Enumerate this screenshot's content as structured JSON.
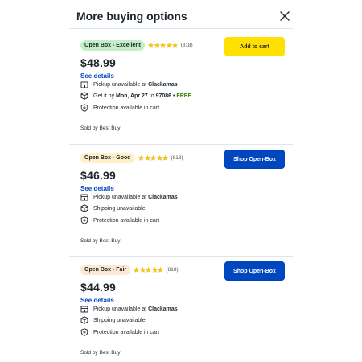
{
  "header": {
    "title": "More buying options"
  },
  "colors": {
    "excellent_badge": "#c3eec8",
    "good_badge": "#fff0c8",
    "fair_badge": "#fde8d4",
    "primary_blue": "#0046be",
    "cart_yellow": "#ffe000",
    "star": "#ffc800",
    "free_green": "#318000"
  },
  "offers": [
    {
      "condition": "Open Box - Excellent",
      "stars": 5,
      "rating_count": "(818)",
      "price": "$48.99",
      "see_details": "See details",
      "pickup_prefix": "Pickup unavailable at",
      "pickup_store": "Clackamas",
      "delivery_prefix": "Get it by",
      "delivery_date": "Mon, Apr 27",
      "delivery_to": "to",
      "delivery_zip": "97086",
      "delivery_sep": "•",
      "delivery_cost": "FREE",
      "protection": "Protection available in cart",
      "sold_by": "Sold by Best Buy",
      "button_label": "Add to cart"
    },
    {
      "condition": "Open Box - Good",
      "stars": 5,
      "rating_count": "(818)",
      "price": "$46.99",
      "see_details": "See details",
      "pickup_prefix": "Pickup unavailable at",
      "pickup_store": "Clackamas",
      "shipping": "Shipping unavailable",
      "protection": "Protection available in cart",
      "sold_by": "Sold by Best Buy",
      "button_label": "Shop Open-Box"
    },
    {
      "condition": "Open Box - Fair",
      "stars": 5,
      "rating_count": "(818)",
      "price": "$44.99",
      "see_details": "See details",
      "pickup_prefix": "Pickup unavailable at",
      "pickup_store": "Clackamas",
      "shipping": "Shipping unavailable",
      "protection": "Protection available in cart",
      "sold_by": "Sold by Best Buy",
      "button_label": "Shop Open-Box"
    }
  ]
}
